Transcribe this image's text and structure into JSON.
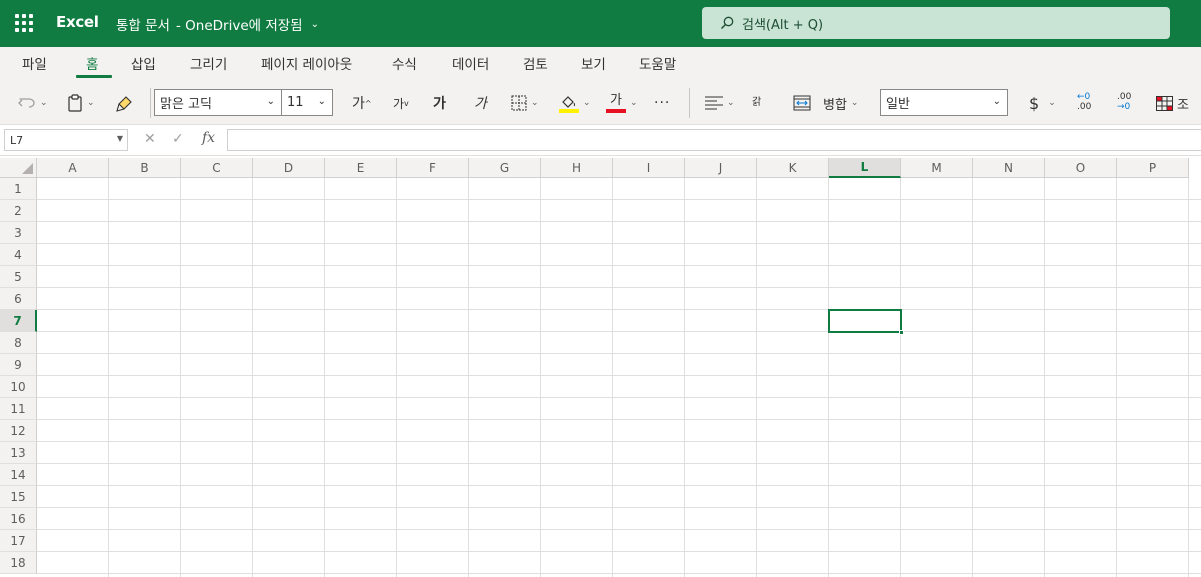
{
  "titlebar": {
    "app_name": "Excel",
    "doc_title": "통합 문서",
    "save_status": "- OneDrive에 저장됨",
    "search_placeholder": "검색(Alt + Q)"
  },
  "tabs": [
    "파일",
    "홈",
    "삽입",
    "그리기",
    "페이지 레이아웃",
    "수식",
    "데이터",
    "검토",
    "보기",
    "도움말"
  ],
  "active_tab": "홈",
  "ribbon": {
    "font_name": "맑은 고딕",
    "font_size": "11",
    "grow_font": "가",
    "shrink_font": "가",
    "bold": "가",
    "italic": "가",
    "font_color_glyph": "가",
    "wrap_text": "갉",
    "merge_label": "병합",
    "number_format": "일반",
    "currency": "$",
    "increase_decimal": ".00",
    "decrease_decimal": ".00",
    "conditional_format_label": "조",
    "more": "···"
  },
  "colors": {
    "brand": "#107c41",
    "fill_indicator": "#fff100",
    "font_color_indicator": "#e81123"
  },
  "formula_bar": {
    "name_box": "L7",
    "fx": "fx",
    "content": ""
  },
  "sheet": {
    "columns": [
      "A",
      "B",
      "C",
      "D",
      "E",
      "F",
      "G",
      "H",
      "I",
      "J",
      "K",
      "L",
      "M",
      "N",
      "O",
      "P"
    ],
    "rows": [
      "1",
      "2",
      "3",
      "4",
      "5",
      "6",
      "7",
      "8",
      "9",
      "10",
      "11",
      "12",
      "13",
      "14",
      "15",
      "16",
      "17",
      "18"
    ],
    "selected_column": "L",
    "selected_row": "7"
  }
}
